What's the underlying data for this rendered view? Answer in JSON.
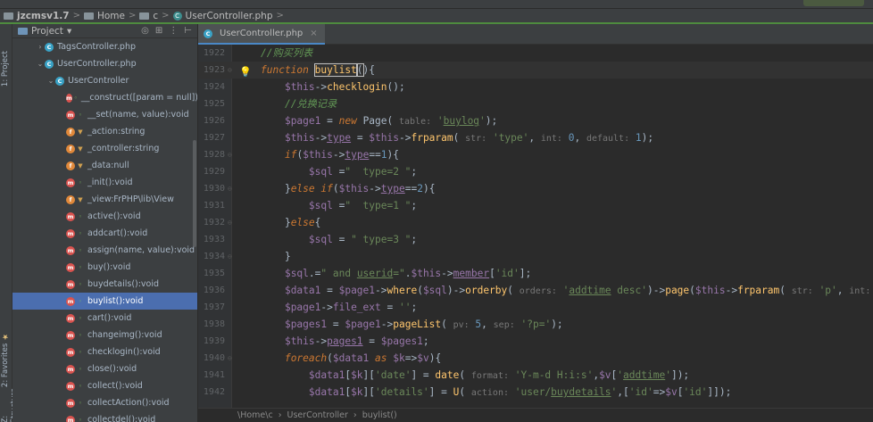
{
  "navbar": {
    "project": "jzcmsv1.7",
    "crumbs": [
      "Home",
      "c"
    ],
    "file": "UserController.php"
  },
  "toolwindows": {
    "project": "1: Project",
    "favorites": "2: Favorites",
    "structure": "Z: Structure"
  },
  "project_panel": {
    "title": "Project",
    "tree": [
      {
        "label": "TagsController.php",
        "kind": "file",
        "indent": 36,
        "arrow": ">"
      },
      {
        "label": "UserController.php",
        "kind": "file",
        "indent": 36,
        "arrow": "v"
      },
      {
        "label": "UserController",
        "kind": "class",
        "indent": 48,
        "arrow": "v"
      },
      {
        "label": "__construct([param = null]):f",
        "kind": "method",
        "vis": "pub",
        "indent": 70
      },
      {
        "label": "__set(name, value):void",
        "kind": "method",
        "vis": "pub",
        "indent": 70
      },
      {
        "label": "_action:string",
        "kind": "field",
        "vis": "priv",
        "indent": 70
      },
      {
        "label": "_controller:string",
        "kind": "field",
        "vis": "priv",
        "indent": 70
      },
      {
        "label": "_data:null",
        "kind": "field",
        "vis": "priv",
        "indent": 70
      },
      {
        "label": "_init():void",
        "kind": "method",
        "vis": "pub",
        "indent": 70
      },
      {
        "label": "_view:FrPHP\\lib\\View",
        "kind": "field",
        "vis": "priv",
        "indent": 70
      },
      {
        "label": "active():void",
        "kind": "method",
        "vis": "pub",
        "indent": 70
      },
      {
        "label": "addcart():void",
        "kind": "method",
        "vis": "pub",
        "indent": 70
      },
      {
        "label": "assign(name, value):void",
        "kind": "method",
        "vis": "pub",
        "indent": 70
      },
      {
        "label": "buy():void",
        "kind": "method",
        "vis": "pub",
        "indent": 70
      },
      {
        "label": "buydetails():void",
        "kind": "method",
        "vis": "pub",
        "indent": 70
      },
      {
        "label": "buylist():void",
        "kind": "method",
        "vis": "pub",
        "indent": 70,
        "selected": true
      },
      {
        "label": "cart():void",
        "kind": "method",
        "vis": "pub",
        "indent": 70
      },
      {
        "label": "changeimg():void",
        "kind": "method",
        "vis": "pub",
        "indent": 70
      },
      {
        "label": "checklogin():void",
        "kind": "method",
        "vis": "pub",
        "indent": 70
      },
      {
        "label": "close():void",
        "kind": "method",
        "vis": "pub",
        "indent": 70
      },
      {
        "label": "collect():void",
        "kind": "method",
        "vis": "pub",
        "indent": 70
      },
      {
        "label": "collectAction():void",
        "kind": "method",
        "vis": "pub",
        "indent": 70
      },
      {
        "label": "collectdel():void",
        "kind": "method",
        "vis": "pub",
        "indent": 70
      }
    ]
  },
  "editor": {
    "tab_label": "UserController.php",
    "line_start": 1922,
    "bottom_breadcrumb": [
      "\\Home\\c",
      "UserController",
      "buylist()"
    ]
  },
  "colors": {
    "accent": "#4b6eaf",
    "keyword": "#cc7832",
    "string": "#6a8759",
    "variable": "#9876aa",
    "function": "#ffc66d",
    "number": "#6897bb",
    "comment": "#629755"
  }
}
